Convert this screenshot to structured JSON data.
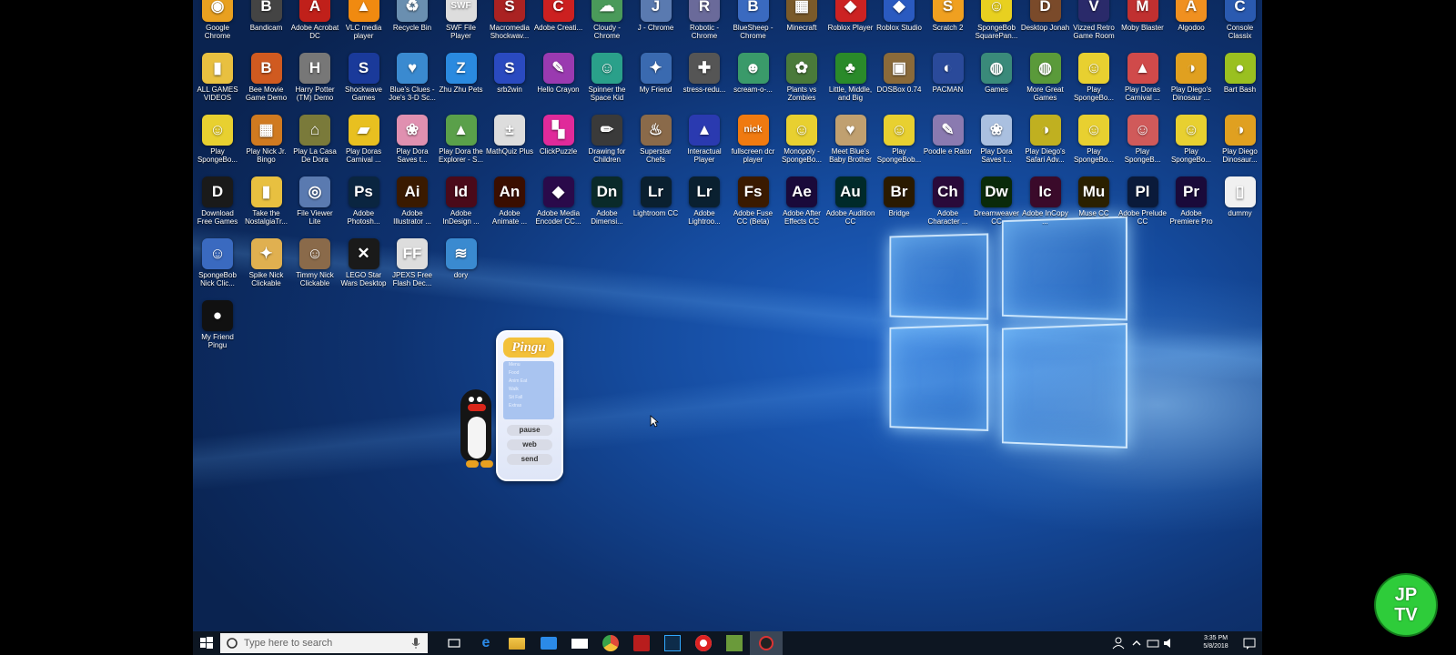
{
  "desktop": {
    "icons": [
      {
        "label": "Google Chrome",
        "glyph": "◉",
        "color": "#e8a020"
      },
      {
        "label": "Bandicam",
        "glyph": "B",
        "color": "#444"
      },
      {
        "label": "Adobe Acrobat DC",
        "glyph": "A",
        "color": "#c0201a"
      },
      {
        "label": "VLC media player",
        "glyph": "▲",
        "color": "#f08a10"
      },
      {
        "label": "Recycle Bin",
        "glyph": "♻",
        "color": "#6a8fb0"
      },
      {
        "label": "SWF File Player",
        "glyph": "SWF",
        "color": "#ddd"
      },
      {
        "label": "Macromedia Shockwav...",
        "glyph": "S",
        "color": "#aa2222"
      },
      {
        "label": "Adobe Creati...",
        "glyph": "C",
        "color": "#cc2020"
      },
      {
        "label": "Cloudy - Chrome",
        "glyph": "☁",
        "color": "#4a9a5a"
      },
      {
        "label": "J - Chrome",
        "glyph": "J",
        "color": "#5a7ab0"
      },
      {
        "label": "Robotic - Chrome",
        "glyph": "R",
        "color": "#6a6a9a"
      },
      {
        "label": "BlueSheep - Chrome",
        "glyph": "B",
        "color": "#3a6ac0"
      },
      {
        "label": "Minecraft",
        "glyph": "▦",
        "color": "#7a5a2a"
      },
      {
        "label": "Roblox Player",
        "glyph": "◆",
        "color": "#c22"
      },
      {
        "label": "Roblox Studio",
        "glyph": "◆",
        "color": "#2a5ac0"
      },
      {
        "label": "Scratch 2",
        "glyph": "S",
        "color": "#f0a020"
      },
      {
        "label": "SpongeBob SquarePan...",
        "glyph": "☺",
        "color": "#e8d020"
      },
      {
        "label": "Desktop Jonah",
        "glyph": "D",
        "color": "#7a4a2a"
      },
      {
        "label": "Vizzed Retro Game Room",
        "glyph": "V",
        "color": "#2a2a6a"
      },
      {
        "label": "Moby Blaster",
        "glyph": "M",
        "color": "#c03030"
      },
      {
        "label": "Algodoo",
        "glyph": "A",
        "color": "#f09020"
      },
      {
        "label": "Console Classix",
        "glyph": "C",
        "color": "#2a5ab0"
      },
      {
        "label": "ALL GAMES VIDEOS",
        "glyph": "▮",
        "color": "#e8c040"
      },
      {
        "label": "Bee Movie Game Demo",
        "glyph": "B",
        "color": "#d05a20"
      },
      {
        "label": "Harry Potter (TM) Demo",
        "glyph": "H",
        "color": "#777"
      },
      {
        "label": "Shockwave Games",
        "glyph": "S",
        "color": "#1a3a9a"
      },
      {
        "label": "Blue's Clues - Joe's 3-D Sc...",
        "glyph": "♥",
        "color": "#3a8ad0"
      },
      {
        "label": "Zhu Zhu Pets",
        "glyph": "Z",
        "color": "#2a8ae0"
      },
      {
        "label": "srb2win",
        "glyph": "S",
        "color": "#2a4ac0"
      },
      {
        "label": "Hello Crayon",
        "glyph": "✎",
        "color": "#9a3ab0"
      },
      {
        "label": "Spinner the Space Kid",
        "glyph": "☺",
        "color": "#2aa08a"
      },
      {
        "label": "My Friend",
        "glyph": "✦",
        "color": "#3a6ab0"
      },
      {
        "label": "stress-redu...",
        "glyph": "✚",
        "color": "#555"
      },
      {
        "label": "scream-o-...",
        "glyph": "☻",
        "color": "#3a9a6a"
      },
      {
        "label": "Plants vs Zombies",
        "glyph": "✿",
        "color": "#4a7a3a"
      },
      {
        "label": "Little, Middle, and Big",
        "glyph": "♣",
        "color": "#2a8a2a"
      },
      {
        "label": "DOSBox 0.74",
        "glyph": "▣",
        "color": "#8a6a3a"
      },
      {
        "label": "PACMAN",
        "glyph": "◐",
        "color": "#2a4a9a"
      },
      {
        "label": "Games",
        "glyph": "◍",
        "color": "#3a8a7a"
      },
      {
        "label": "More Great Games",
        "glyph": "◍",
        "color": "#5a9a3a"
      },
      {
        "label": "Play SpongeBo...",
        "glyph": "☺",
        "color": "#e8d030"
      },
      {
        "label": "Play Doras Carnival ...",
        "glyph": "▲",
        "color": "#d04a4a"
      },
      {
        "label": "Play Diego's Dinosaur ...",
        "glyph": "◑",
        "color": "#e0a020"
      },
      {
        "label": "Bart Bash",
        "glyph": "●",
        "color": "#9ac020"
      },
      {
        "label": "Play SpongeBo...",
        "glyph": "☺",
        "color": "#e8d030"
      },
      {
        "label": "Play Nick Jr. Bingo",
        "glyph": "▦",
        "color": "#d07a20"
      },
      {
        "label": "Play La Casa De Dora",
        "glyph": "⌂",
        "color": "#7a7a3a"
      },
      {
        "label": "Play Doras Carnival ...",
        "glyph": "▰",
        "color": "#e8c020"
      },
      {
        "label": "Play Dora Saves t...",
        "glyph": "❀",
        "color": "#e090b0"
      },
      {
        "label": "Play Dora the Explorer - S...",
        "glyph": "▲",
        "color": "#5aa04a"
      },
      {
        "label": "MathQuiz Plus",
        "glyph": "±",
        "color": "#ddd"
      },
      {
        "label": "ClickPuzzle",
        "glyph": "▚",
        "color": "#e02a9a"
      },
      {
        "label": "Drawing for Children",
        "glyph": "✏",
        "color": "#3a3a3a"
      },
      {
        "label": "Superstar Chefs",
        "glyph": "♨",
        "color": "#8a6a4a"
      },
      {
        "label": "Interactual Player",
        "glyph": "▲",
        "color": "#2a3ab0"
      },
      {
        "label": "fullscreen dcr player",
        "glyph": "nick",
        "color": "#f07a10"
      },
      {
        "label": "Monopoly - SpongeBo...",
        "glyph": "☺",
        "color": "#e8d030"
      },
      {
        "label": "Meet Blue's Baby Brother",
        "glyph": "♥",
        "color": "#c0a070"
      },
      {
        "label": "Play SpongeBob...",
        "glyph": "☺",
        "color": "#e8d030"
      },
      {
        "label": "Poodle e Rator",
        "glyph": "✎",
        "color": "#8a7ab0"
      },
      {
        "label": "Play Dora Saves t...",
        "glyph": "❀",
        "color": "#aac0e0"
      },
      {
        "label": "Play Diego's Safari Adv...",
        "glyph": "◑",
        "color": "#c0b020"
      },
      {
        "label": "Play SpongeBo...",
        "glyph": "☺",
        "color": "#e8d030"
      },
      {
        "label": "Play SpongeB...",
        "glyph": "☺",
        "color": "#d05a5a"
      },
      {
        "label": "Play SpongeBo...",
        "glyph": "☺",
        "color": "#e8d030"
      },
      {
        "label": "Play Diego Dinosaur...",
        "glyph": "◑",
        "color": "#e0a020"
      },
      {
        "label": "Download Free Games",
        "glyph": "D",
        "color": "#1a1a1a"
      },
      {
        "label": "Take the NostalgiaTr...",
        "glyph": "▮",
        "color": "#e8c040"
      },
      {
        "label": "File Viewer Lite",
        "glyph": "◎",
        "color": "#5a7ab0"
      },
      {
        "label": "Adobe Photosh...",
        "glyph": "Ps",
        "color": "#0a2540"
      },
      {
        "label": "Adobe Illustrator ...",
        "glyph": "Ai",
        "color": "#3a1a00"
      },
      {
        "label": "Adobe InDesign ...",
        "glyph": "Id",
        "color": "#4a0a1a"
      },
      {
        "label": "Adobe Animate ...",
        "glyph": "An",
        "color": "#3a0e00"
      },
      {
        "label": "Adobe Media Encoder CC...",
        "glyph": "◆",
        "color": "#2a0a4a"
      },
      {
        "label": "Adobe Dimensi...",
        "glyph": "Dn",
        "color": "#0a2a2a"
      },
      {
        "label": "Lightroom CC",
        "glyph": "Lr",
        "color": "#0a2030"
      },
      {
        "label": "Adobe Lightroo...",
        "glyph": "Lr",
        "color": "#0a2030"
      },
      {
        "label": "Adobe Fuse CC (Beta)",
        "glyph": "Fs",
        "color": "#3a1a00"
      },
      {
        "label": "Adobe After Effects CC",
        "glyph": "Ae",
        "color": "#1a0a3a"
      },
      {
        "label": "Adobe Audition CC",
        "glyph": "Au",
        "color": "#002a2a"
      },
      {
        "label": "Bridge",
        "glyph": "Br",
        "color": "#2a1a00"
      },
      {
        "label": "Adobe Character ...",
        "glyph": "Ch",
        "color": "#2a0a3a"
      },
      {
        "label": "Dreamweaver CC",
        "glyph": "Dw",
        "color": "#0a2a0a"
      },
      {
        "label": "Adobe InCopy ...",
        "glyph": "Ic",
        "color": "#3a0a2a"
      },
      {
        "label": "Muse CC",
        "glyph": "Mu",
        "color": "#2a2000"
      },
      {
        "label": "Adobe Prelude CC",
        "glyph": "Pl",
        "color": "#0a1a3a"
      },
      {
        "label": "Adobe Premiere Pro",
        "glyph": "Pr",
        "color": "#1a0a3a"
      },
      {
        "label": "dummy",
        "glyph": "▯",
        "color": "#f0f0f0"
      },
      {
        "label": "SpongeBob Nick Clic...",
        "glyph": "☺",
        "color": "#3a6ac0"
      },
      {
        "label": "Spike Nick Clickable",
        "glyph": "✦",
        "color": "#e0b050"
      },
      {
        "label": "Timmy Nick Clickable",
        "glyph": "☺",
        "color": "#8a6a4a"
      },
      {
        "label": "LEGO Star Wars Desktop",
        "glyph": "✕",
        "color": "#1a1a1a"
      },
      {
        "label": "JPEXS Free Flash Dec...",
        "glyph": "FF",
        "color": "#ddd"
      },
      {
        "label": "dory",
        "glyph": "≋",
        "color": "#3a8ad0"
      },
      {
        "label": "My Friend Pingu",
        "glyph": "●",
        "color": "#111"
      }
    ]
  },
  "pingu_widget": {
    "logo": "Pingu",
    "list": [
      "Menu",
      "Food",
      "Anim Eat",
      "Walk",
      "Sit Fall",
      "Extras"
    ],
    "buttons": {
      "pause": "pause",
      "web": "web",
      "send": "send"
    }
  },
  "taskbar": {
    "search_placeholder": "Type here to search",
    "time": "3:35 PM",
    "date": "5/8/2018"
  },
  "watermark": {
    "line1": "JP",
    "line2": "TV"
  }
}
